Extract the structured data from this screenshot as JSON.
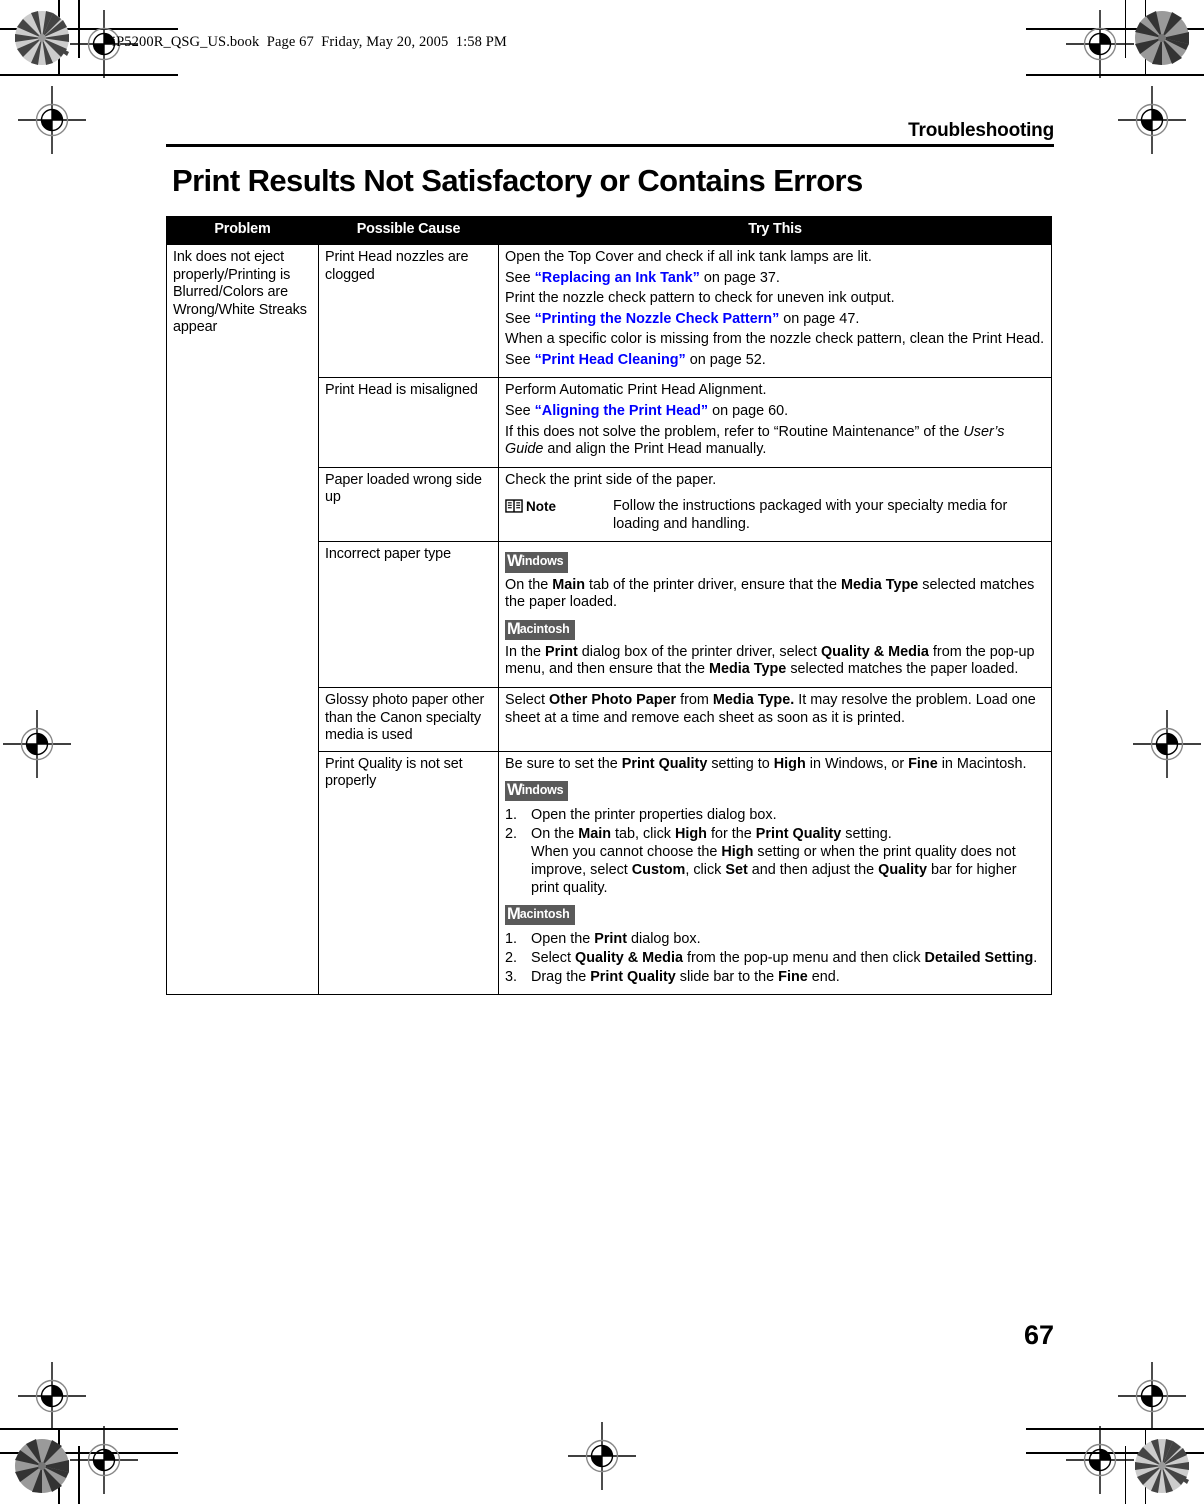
{
  "file_header": "iP5200R_QSG_US.book  Page 67  Friday, May 20, 2005  1:58 PM",
  "chapter": "Troubleshooting",
  "title": "Print Results Not Satisfactory or Contains Errors",
  "page_number": "67",
  "colors": {
    "link": "#0000ff",
    "header_bg": "#000000",
    "badge_bg": "#5a5a5a",
    "text": "#000000"
  },
  "table": {
    "headers": {
      "problem": "Problem",
      "cause": "Possible Cause",
      "try": "Try This"
    },
    "problem": "Ink does not eject properly/Printing is Blurred/Colors are Wrong/White Streaks appear",
    "rows": [
      {
        "cause": "Print Head nozzles are clogged",
        "lines": {
          "l1": "Open the Top Cover and check if all ink tank lamps are lit.",
          "l2_pre": "See ",
          "l2_link": "“Replacing an Ink Tank”",
          "l2_post": " on page 37.",
          "l3": "Print the nozzle check pattern to check for uneven ink output.",
          "l4_pre": "See ",
          "l4_link": "“Printing the Nozzle Check Pattern”",
          "l4_post": " on page 47.",
          "l5": "When a specific color is missing from the nozzle check pattern, clean the Print Head.",
          "l6_pre": "See ",
          "l6_link": "“Print Head Cleaning”",
          "l6_post": " on page 52."
        }
      },
      {
        "cause": "Print Head is misaligned",
        "lines": {
          "l1": "Perform Automatic Print Head Alignment.",
          "l2_pre": "See ",
          "l2_link": "“Aligning the Print Head”",
          "l2_post": " on page 60.",
          "l3_a": "If this does not solve the problem, refer to “Routine Maintenance” of the ",
          "l3_italic": "User’s Guide",
          "l3_b": " and align the Print Head manually."
        }
      },
      {
        "cause": "Paper loaded wrong side up",
        "lines": {
          "l1": "Check the print side of the paper.",
          "note_label": "Note",
          "note_icon": "book-icon",
          "note_text": "Follow the instructions packaged with your specialty media for loading and handling."
        }
      },
      {
        "cause": "Incorrect paper type",
        "lines": {
          "badge_win_cap": "W",
          "badge_win_rest": "indows",
          "win_a": "On the ",
          "win_b1": "Main",
          "win_c": " tab of the printer driver, ensure that the ",
          "win_b2": "Media Type",
          "win_d": " selected matches the paper loaded.",
          "badge_mac_cap": "M",
          "badge_mac_rest": "acintosh",
          "mac_a": "In the ",
          "mac_b1": "Print",
          "mac_c": " dialog box of the printer driver, select ",
          "mac_b2": "Quality & Media",
          "mac_d": " from the pop-up menu, and then ensure that the ",
          "mac_b3": "Media Type",
          "mac_e": " selected matches the paper loaded."
        }
      },
      {
        "cause": "Glossy photo paper other than the Canon specialty media is used",
        "lines": {
          "a": "Select ",
          "b1": "Other Photo Paper",
          "c": " from ",
          "b2": "Media Type.",
          "d": " It may resolve the problem. Load one sheet at a time and remove each sheet as soon as it is printed."
        }
      },
      {
        "cause": "Print Quality is not set properly",
        "lines": {
          "intro_a": "Be sure to set the ",
          "intro_b1": "Print Quality",
          "intro_c": " setting to ",
          "intro_b2": "High",
          "intro_d": " in Windows, or ",
          "intro_b3": "Fine",
          "intro_e": " in Macintosh.",
          "badge_win_cap": "W",
          "badge_win_rest": "indows",
          "win_items": [
            {
              "num": "1.",
              "a": "Open the printer properties dialog box."
            },
            {
              "num": "2.",
              "a": "On the ",
              "b1": "Main",
              "c": " tab, click ",
              "b2": "High",
              "d": " for the ",
              "b3": "Print Quality",
              "e": " setting.",
              "f": "When you cannot choose the ",
              "b4": "High",
              "g": " setting or when the print quality does not improve, select ",
              "b5": "Custom",
              "h": ", click ",
              "b6": "Set",
              "i": " and then adjust the ",
              "b7": "Quality",
              "j": " bar for higher print quality."
            }
          ],
          "badge_mac_cap": "M",
          "badge_mac_rest": "acintosh",
          "mac_items": [
            {
              "num": "1.",
              "a": "Open the ",
              "b1": "Print",
              "c": " dialog box."
            },
            {
              "num": "2.",
              "a": "Select ",
              "b1": "Quality & Media",
              "c": " from the pop-up menu and then click ",
              "b2": "Detailed Setting",
              "d": "."
            },
            {
              "num": "3.",
              "a": "Drag the ",
              "b1": "Print Quality",
              "c": " slide bar to the ",
              "b2": "Fine",
              "d": " end."
            }
          ]
        }
      }
    ]
  }
}
